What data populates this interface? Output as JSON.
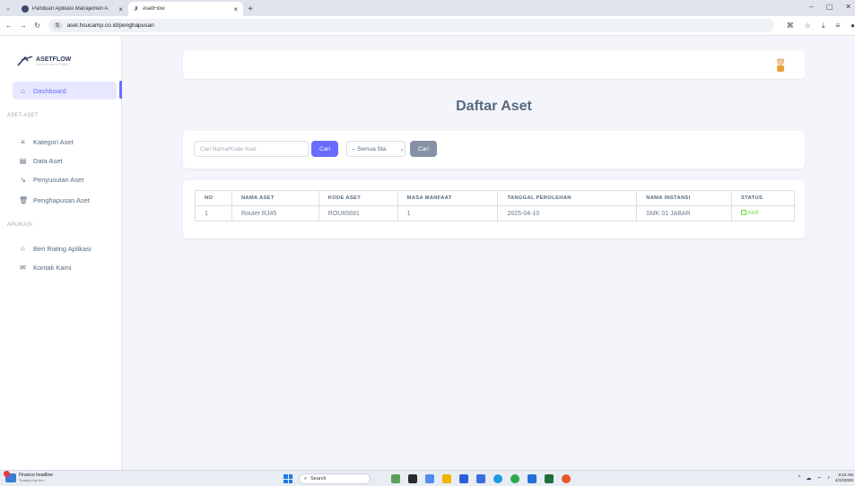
{
  "browser": {
    "tabs": [
      {
        "title": "Panduan Aplikasi Manajemen A"
      },
      {
        "title": "AsetFlow"
      }
    ],
    "url": "aset.hsucamp.co.id/penghapusan"
  },
  "sidebar": {
    "brand": "ASETFLOW",
    "tagline": "Kelola Mudah & Praktis",
    "dashboard": "Dashboard",
    "section_aset": "ASET-ASET",
    "items_aset": [
      {
        "label": "Kategori Aset",
        "icon": "list-icon"
      },
      {
        "label": "Data Aset",
        "icon": "table-icon"
      },
      {
        "label": "Penyusutan Aset",
        "icon": "chart-down-icon"
      },
      {
        "label": "Penghapusan Aset",
        "icon": "trash-icon"
      }
    ],
    "section_app": "APLIKASI",
    "items_app": [
      {
        "label": "Beri Rating Aplikasi",
        "icon": "star-icon"
      },
      {
        "label": "Kontak Kami",
        "icon": "mail-icon"
      }
    ]
  },
  "main": {
    "title": "Daftar Aset",
    "filter": {
      "search_placeholder": "Cari Nama/Kode Aset",
      "search_button": "Cari",
      "status_value": "-- Semua Sta",
      "filter_button": "Cari"
    },
    "table": {
      "headers": [
        "NO",
        "NAMA ASET",
        "KODE ASET",
        "MASA MANFAAT",
        "TANGGAL PEROLEHAN",
        "NAMA INSTANSI",
        "STATUS"
      ],
      "rows": [
        [
          "1",
          "Router RJ45",
          "ROU65691",
          "1",
          "2025-04-10",
          "SMK 01 JABAR",
          "Aktif"
        ]
      ]
    }
  },
  "taskbar": {
    "news_title": "Finance headline",
    "news_sub": "Trump's top tra...",
    "search": "Search",
    "time": "9:24 AM",
    "date": "4/10/2025"
  },
  "colors": {
    "primary": "#696cff",
    "success": "#71dd37",
    "secondary": "#8592a3"
  }
}
